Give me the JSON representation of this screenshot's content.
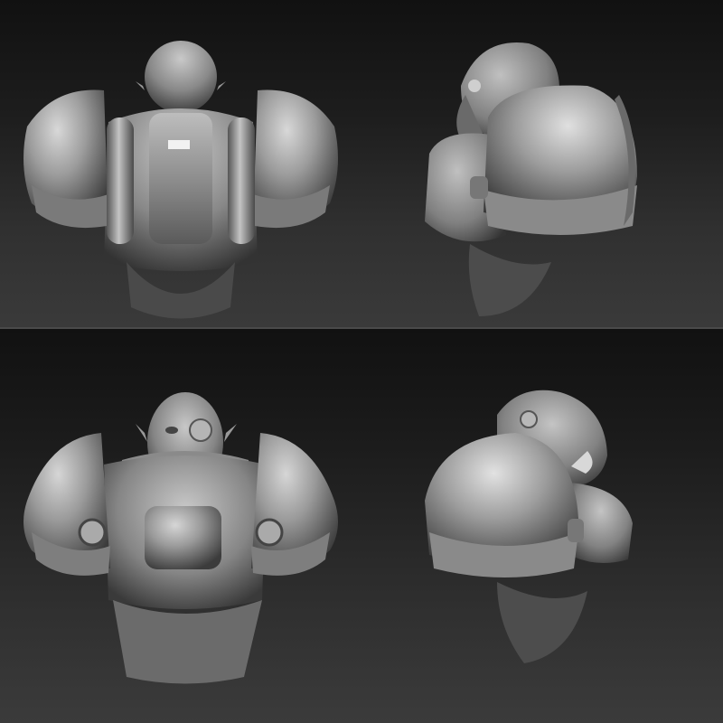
{
  "render": {
    "material_color": "#9a9a9a",
    "highlight_color": "#e6e6e6",
    "shadow_color": "#2a2a2a",
    "background_top": "#111111",
    "background_bottom": "#3a3a3a"
  },
  "views": [
    {
      "subject": "armored-orc-bust",
      "angle": "back"
    },
    {
      "subject": "armored-orc-bust",
      "angle": "right-profile"
    },
    {
      "subject": "armored-orc-bust",
      "angle": "front"
    },
    {
      "subject": "armored-orc-bust",
      "angle": "left-three-quarter"
    }
  ]
}
